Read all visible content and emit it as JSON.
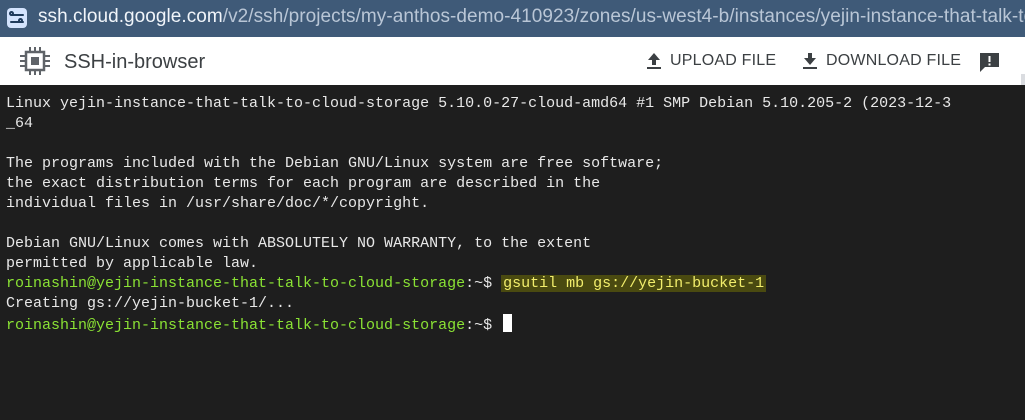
{
  "browser": {
    "url_host": "ssh.cloud.google.com",
    "url_path": "/v2/ssh/projects/my-anthos-demo-410923/zones/us-west4-b/instances/yejin-instance-that-talk-to-clou"
  },
  "toolbar": {
    "title": "SSH-in-browser",
    "upload_label": "UPLOAD FILE",
    "download_label": "DOWNLOAD FILE"
  },
  "terminal": {
    "lines": [
      "Linux yejin-instance-that-talk-to-cloud-storage 5.10.0-27-cloud-amd64 #1 SMP Debian 5.10.205-2 (2023-12-3",
      "_64",
      "",
      "The programs included with the Debian GNU/Linux system are free software;",
      "the exact distribution terms for each program are described in the",
      "individual files in /usr/share/doc/*/copyright.",
      "",
      "Debian GNU/Linux comes with ABSOLUTELY NO WARRANTY, to the extent",
      "permitted by applicable law."
    ],
    "prompt_user": "roinashin@yejin-instance-that-talk-to-cloud-storage",
    "prompt_suffix": ":~$ ",
    "command": "gsutil mb gs://yejin-bucket-1",
    "output": "Creating gs://yejin-bucket-1/...",
    "colors": {
      "background": "#1e1e1e",
      "prompt": "#8ae234",
      "highlight_text": "#f2ee6c"
    }
  }
}
